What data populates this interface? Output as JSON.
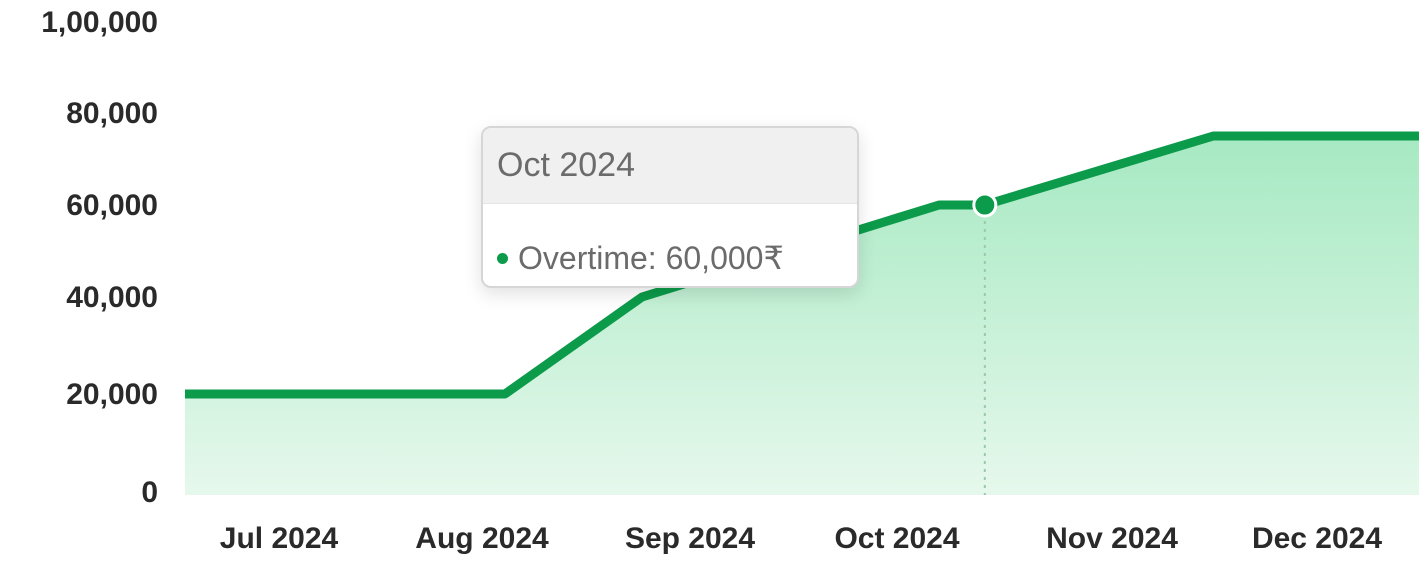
{
  "colors": {
    "line": "#0b9b4a",
    "area_top": "#a6e9c2",
    "area_bottom": "#e6f8ec",
    "marker": "#0b9b4a",
    "crosshair": "#9bc9a9"
  },
  "chart_data": {
    "type": "area",
    "categories": [
      "Jul 2024",
      "Aug 2024",
      "Sep 2024",
      "Oct 2024",
      "Nov 2024",
      "Dec 2024"
    ],
    "x_positions": [
      {
        "label": "Jul 2024",
        "offset": 0
      },
      {
        "label": "",
        "offset": 1
      }
    ],
    "points": [
      {
        "x": 0.0,
        "y": 20000
      },
      {
        "x": 1.4,
        "y": 20000
      },
      {
        "x": 2.0,
        "y": 40000
      },
      {
        "x": 3.3,
        "y": 60000
      },
      {
        "x": 3.5,
        "y": 60000
      },
      {
        "x": 4.5,
        "y": 75000
      },
      {
        "x": 5.4,
        "y": 75000
      }
    ],
    "series": [
      {
        "name": "Overtime",
        "values": [
          20000,
          20000,
          40000,
          60000,
          75000,
          75000
        ]
      }
    ],
    "y_ticks": [
      {
        "value": 0,
        "label": "0"
      },
      {
        "value": 20000,
        "label": "20,000"
      },
      {
        "value": 40000,
        "label": "40,000"
      },
      {
        "value": 60000,
        "label": "60,000"
      },
      {
        "value": 80000,
        "label": "80,000"
      },
      {
        "value": 100000,
        "label": "1,00,000"
      }
    ],
    "ylim": [
      0,
      100000
    ],
    "x_domain": [
      0,
      5.4
    ],
    "highlight": {
      "x": 3.5,
      "y": 60000
    },
    "tooltip": {
      "title": "Oct 2024",
      "series_label": "Overtime: 60,000₹"
    },
    "title": "",
    "xlabel": "",
    "ylabel": "",
    "grid": false
  }
}
